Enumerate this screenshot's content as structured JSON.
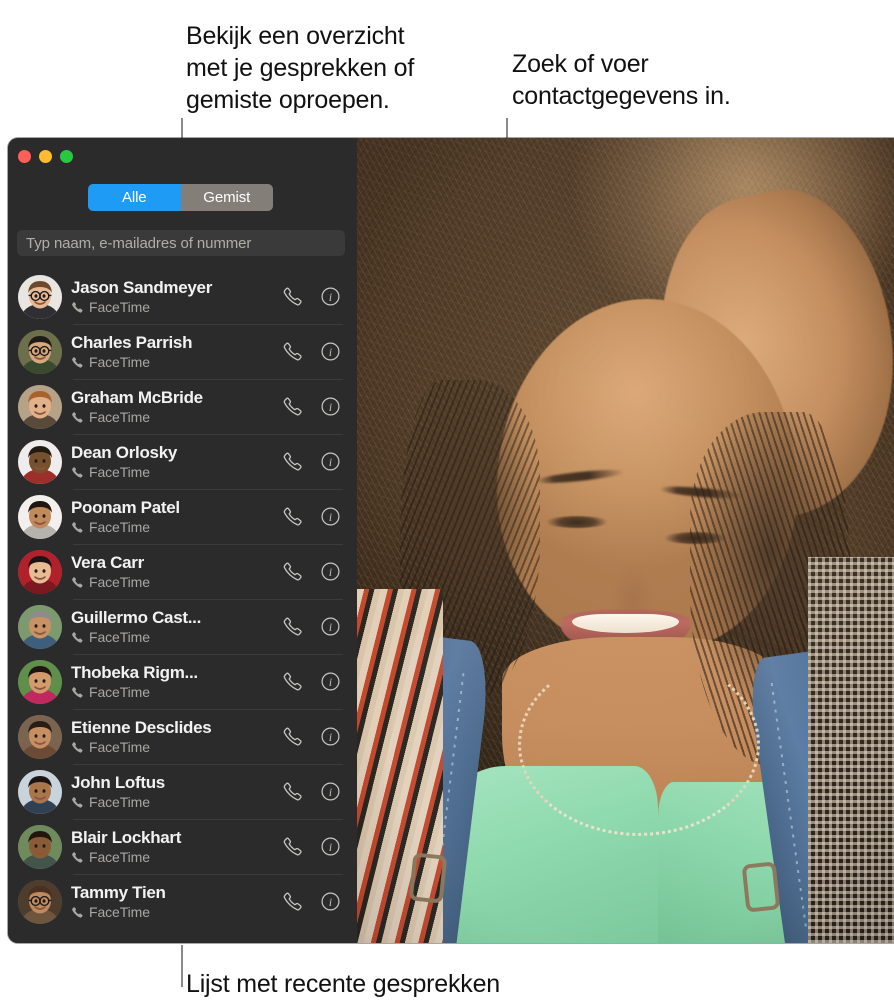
{
  "callouts": {
    "top_left": "Bekijk een overzicht\nmet je gesprekken of\ngemiste oproepen.",
    "top_right": "Zoek of voer\ncontactgegevens in.",
    "bottom": "Lijst met recente gesprekken"
  },
  "window": {
    "traffic_lights": [
      {
        "name": "close",
        "color": "#ff5f57"
      },
      {
        "name": "minimize",
        "color": "#febc2e"
      },
      {
        "name": "zoom",
        "color": "#28c840"
      }
    ]
  },
  "segmented_control": {
    "options": [
      "Alle",
      "Gemist"
    ],
    "selected": "Alle",
    "active_color": "#1e9bf5",
    "inactive_color": "#837e77"
  },
  "search": {
    "value": "",
    "placeholder": "Typ naam, e-mailadres of nummer"
  },
  "contacts": [
    {
      "name": "Jason Sandmeyer",
      "service": "FaceTime"
    },
    {
      "name": "Charles Parrish",
      "service": "FaceTime"
    },
    {
      "name": "Graham McBride",
      "service": "FaceTime"
    },
    {
      "name": "Dean Orlosky",
      "service": "FaceTime"
    },
    {
      "name": "Poonam Patel",
      "service": "FaceTime"
    },
    {
      "name": "Vera Carr",
      "service": "FaceTime"
    },
    {
      "name": "Guillermo Cast...",
      "service": "FaceTime"
    },
    {
      "name": "Thobeka Rigm...",
      "service": "FaceTime"
    },
    {
      "name": "Etienne Desclides",
      "service": "FaceTime"
    },
    {
      "name": "John Loftus",
      "service": "FaceTime"
    },
    {
      "name": "Blair Lockhart",
      "service": "FaceTime"
    },
    {
      "name": "Tammy Tien",
      "service": "FaceTime"
    }
  ],
  "row_actions": {
    "call_icon": "phone-handset-icon",
    "info_icon": "info-circle-icon"
  },
  "video": {
    "description": "FaceTime video of a smiling person with curly hair, mint top and denim overalls"
  }
}
